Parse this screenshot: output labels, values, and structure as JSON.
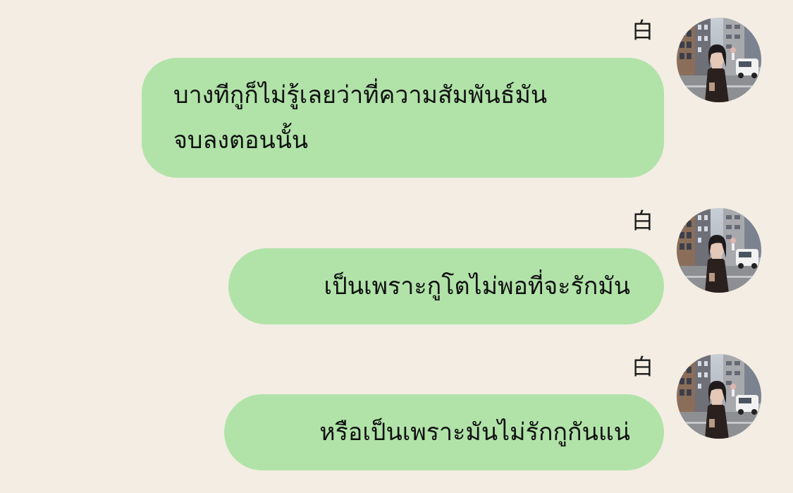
{
  "chat": {
    "messages": [
      {
        "sender": "白",
        "avatar_icon": "profile-photo-avatar",
        "text": "บางทีกูก็ไม่รู้เลยว่าที่ความสัมพันธ์มัน\nจบลงตอนนั้น"
      },
      {
        "sender": "白",
        "avatar_icon": "profile-photo-avatar",
        "text": "เป็นเพราะกูโตไม่พอที่จะรักมัน"
      },
      {
        "sender": "白",
        "avatar_icon": "profile-photo-avatar",
        "text": "หรือเป็นเพราะมันไม่รักกูกันแน่"
      }
    ]
  },
  "colors": {
    "background": "#f3ede3",
    "bubble": "#b1e3a9",
    "text": "#111111"
  }
}
